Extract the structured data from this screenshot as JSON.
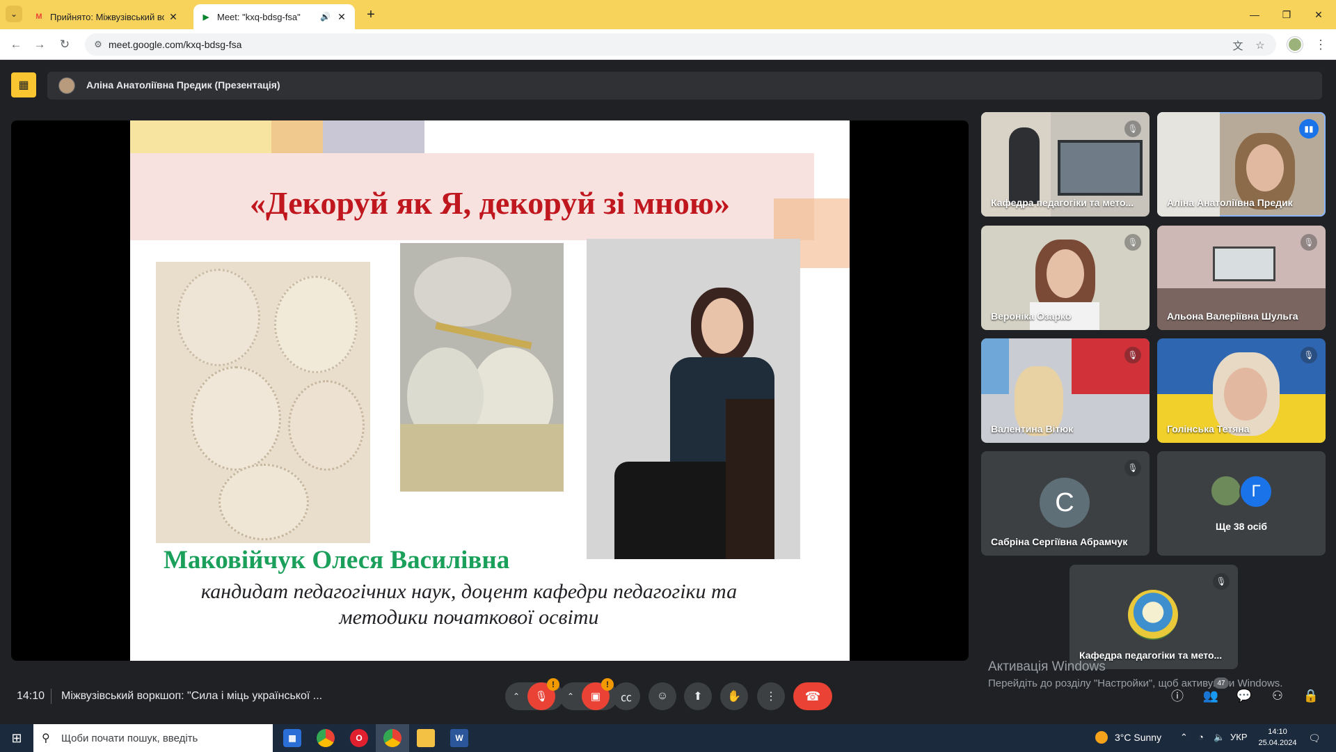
{
  "browser": {
    "tabs": [
      {
        "title": "Прийнято: Міжвузівський во...",
        "favicon": "gmail-icon",
        "active": false
      },
      {
        "title": "Meet: \"kxq-bdsg-fsa\"",
        "favicon": "meet-icon",
        "active": true
      }
    ],
    "url": "meet.google.com/kxq-bdsg-fsa"
  },
  "meet": {
    "presenter_label": "Аліна Анатоліївна Предик (Презентація)",
    "slide": {
      "title": "«Декоруй як Я, декоруй зі мною»",
      "name": "Маковійчук Олеся Василівна",
      "position_line1": "кандидат педагогічних наук, доцент кафедри педагогіки та",
      "position_line2": "методики початкової освіти"
    },
    "participants": [
      {
        "name": "Кафедра педагогіки та мето...",
        "muted": true
      },
      {
        "name": "Аліна Анатоліївна Предик",
        "muted": false,
        "speaking": true
      },
      {
        "name": "Вероніка Озарко",
        "muted": true
      },
      {
        "name": "Альона Валеріївна Шульга",
        "muted": true
      },
      {
        "name": "Валентина Вітюк",
        "muted": true
      },
      {
        "name": "Голінська Тетяна",
        "muted": true
      },
      {
        "name": "Сабріна Сергіївна Абрамчук",
        "initial": "С",
        "muted": true
      },
      {
        "name": "Кафедра педагогіки та мето...",
        "muted": true
      }
    ],
    "more_people": {
      "label": "Ще 38 осіб",
      "initial": "Г"
    },
    "activation": {
      "line1": "Активація Windows",
      "line2": "Перейдіть до розділу \"Настройки\", щоб активувати Windows."
    },
    "time": "14:10",
    "meeting_title": "Міжвузівський воркшоп: \"Сила і міць української ...",
    "participant_count": "47",
    "colors": {
      "end_call": "#ea4335",
      "warning": "#f29900",
      "speaking": "#1a73e8"
    }
  },
  "taskbar": {
    "search_placeholder": "Щоби почати пошук, введіть",
    "weather": "3°C  Sunny",
    "language": "УКР",
    "time": "14:10",
    "date": "25.04.2024"
  }
}
